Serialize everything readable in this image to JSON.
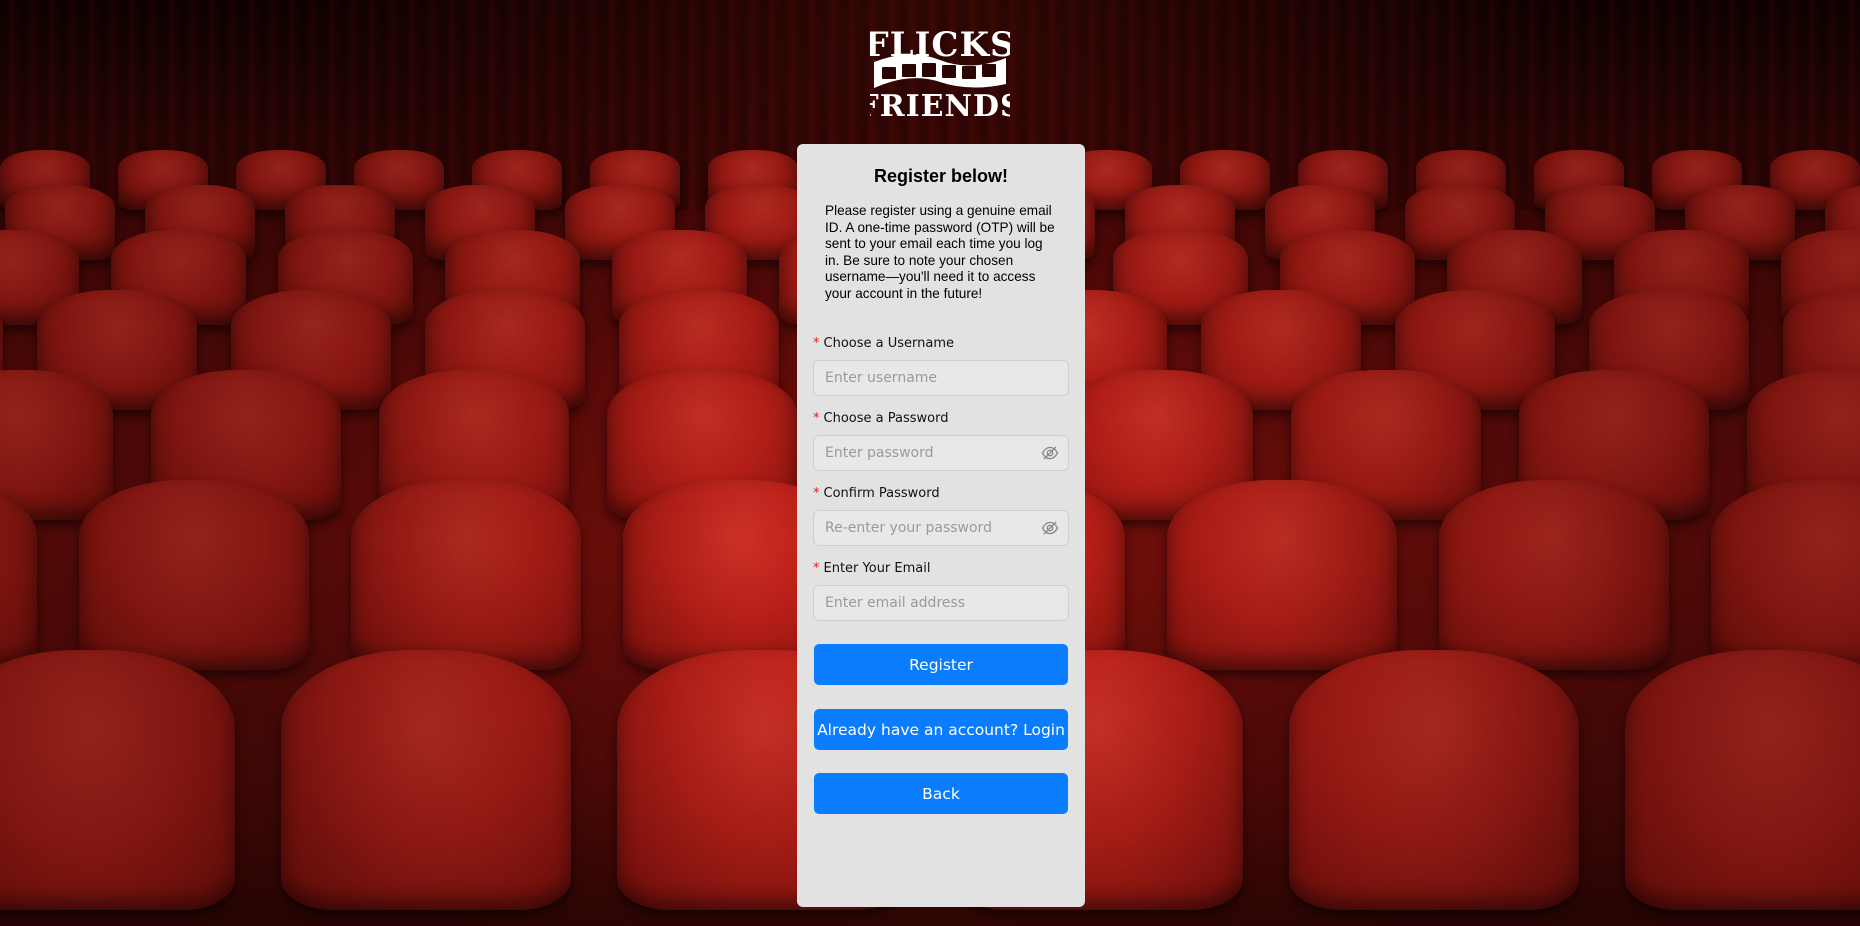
{
  "brand": {
    "logo_line1": "FLICKS",
    "logo_line2": "FRIENDS"
  },
  "form": {
    "title": "Register below!",
    "intro": "Please register using a genuine email ID. A one-time password (OTP) will be sent to your email each time you log in. Be sure to note your chosen username—you'll need it to access your account in the future!",
    "required_marker": "*",
    "username": {
      "label": "Choose a Username",
      "placeholder": "Enter username",
      "value": ""
    },
    "password": {
      "label": "Choose a Password",
      "placeholder": "Enter password",
      "value": "",
      "toggle_icon": "eye-invisible-icon"
    },
    "confirm_password": {
      "label": "Confirm Password",
      "placeholder": "Re-enter your password",
      "value": "",
      "toggle_icon": "eye-invisible-icon"
    },
    "email": {
      "label": "Enter Your Email",
      "placeholder": "Enter email address",
      "value": ""
    },
    "buttons": {
      "register": "Register",
      "login": "Already have an account? Login",
      "back": "Back"
    }
  },
  "colors": {
    "accent": "#0a7dff",
    "card_bg": "#e2e2e2",
    "required": "#e02020",
    "seat_red": "#c8221a"
  }
}
